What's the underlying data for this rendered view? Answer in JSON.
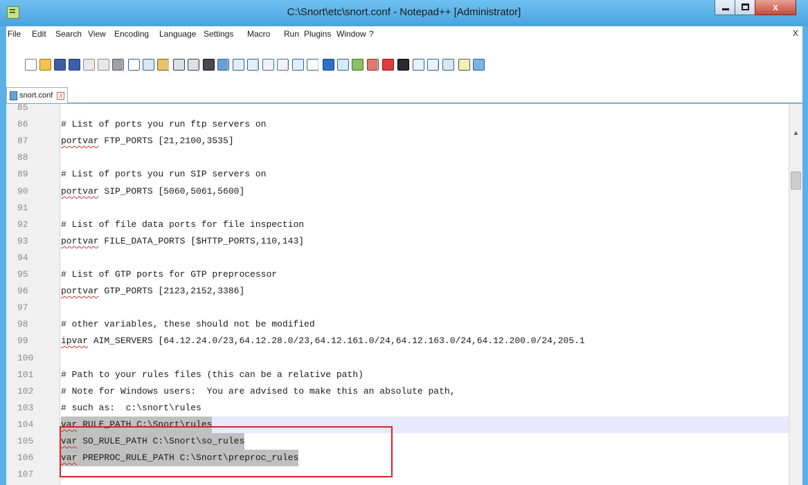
{
  "window": {
    "title": "C:\\Snort\\etc\\snort.conf - Notepad++ [Administrator]",
    "close_glyph": "x"
  },
  "menu": {
    "items": [
      "File",
      "Edit",
      "Search",
      "View",
      "Encoding",
      "Language",
      "Settings",
      "Macro",
      "Run",
      "Plugins",
      "Window",
      "?"
    ],
    "close_label": "X"
  },
  "toolbar": {
    "icons": [
      "new-file-icon",
      "open-file-icon",
      "save-icon",
      "save-all-icon",
      "close-icon",
      "close-all-icon",
      "print-icon",
      "cut-icon",
      "copy-icon",
      "paste-icon",
      "undo-icon",
      "redo-icon",
      "find-icon",
      "replace-icon",
      "zoom-in-icon",
      "zoom-out-icon",
      "sync-vertical-icon",
      "sync-horizontal-icon",
      "word-wrap-icon",
      "show-all-chars-icon",
      "indent-guide-icon",
      "doc-map-icon",
      "function-list-icon",
      "folder-workspace-icon",
      "record-macro-icon",
      "stop-macro-icon",
      "play-macro-icon",
      "run-macro-multiple-icon",
      "save-macro-icon",
      "spellcheck-icon",
      "plugin-icon"
    ]
  },
  "tab": {
    "label": "snort.conf",
    "close_glyph": "x"
  },
  "editor": {
    "lines": [
      {
        "num": "85",
        "text": "",
        "kw": ""
      },
      {
        "num": "86",
        "text": "# List of ports you run ftp servers on",
        "kw": ""
      },
      {
        "num": "87",
        "text": " FTP_PORTS [21,2100,3535]",
        "kw": "portvar"
      },
      {
        "num": "88",
        "text": "",
        "kw": ""
      },
      {
        "num": "89",
        "text": "# List of ports you run SIP servers on",
        "kw": ""
      },
      {
        "num": "90",
        "text": " SIP_PORTS [5060,5061,5600]",
        "kw": "portvar"
      },
      {
        "num": "91",
        "text": "",
        "kw": ""
      },
      {
        "num": "92",
        "text": "# List of file data ports for file inspection",
        "kw": ""
      },
      {
        "num": "93",
        "text": " FILE_DATA_PORTS [$HTTP_PORTS,110,143]",
        "kw": "portvar"
      },
      {
        "num": "94",
        "text": "",
        "kw": ""
      },
      {
        "num": "95",
        "text": "# List of GTP ports for GTP preprocessor",
        "kw": ""
      },
      {
        "num": "96",
        "text": " GTP_PORTS [2123,2152,3386]",
        "kw": "portvar"
      },
      {
        "num": "97",
        "text": "",
        "kw": ""
      },
      {
        "num": "98",
        "text": "# other variables, these should not be modified",
        "kw": ""
      },
      {
        "num": "99",
        "text": " AIM_SERVERS [64.12.24.0/23,64.12.28.0/23,64.12.161.0/24,64.12.163.0/24,64.12.200.0/24,205.1",
        "kw": "ipvar"
      },
      {
        "num": "100",
        "text": "",
        "kw": ""
      },
      {
        "num": "101",
        "text": "# Path to your rules files (this can be a relative path)",
        "kw": ""
      },
      {
        "num": "102",
        "text": "# Note for Windows users:  You are advised to make this an absolute path,",
        "kw": ""
      },
      {
        "num": "103",
        "text": "# such as:  c:\\snort\\rules",
        "kw": ""
      },
      {
        "num": "104",
        "text": " RULE_PATH C:\\Snort\\rules",
        "kw": "var"
      },
      {
        "num": "105",
        "text": " SO_RULE_PATH C:\\Snort\\so_rules",
        "kw": "var"
      },
      {
        "num": "106",
        "text": " PREPROC_RULE_PATH C:\\Snort\\preproc_rules",
        "kw": "var"
      },
      {
        "num": "107",
        "text": "",
        "kw": ""
      }
    ],
    "current_line": "104",
    "highlighted_lines": [
      "104",
      "105",
      "106"
    ]
  }
}
